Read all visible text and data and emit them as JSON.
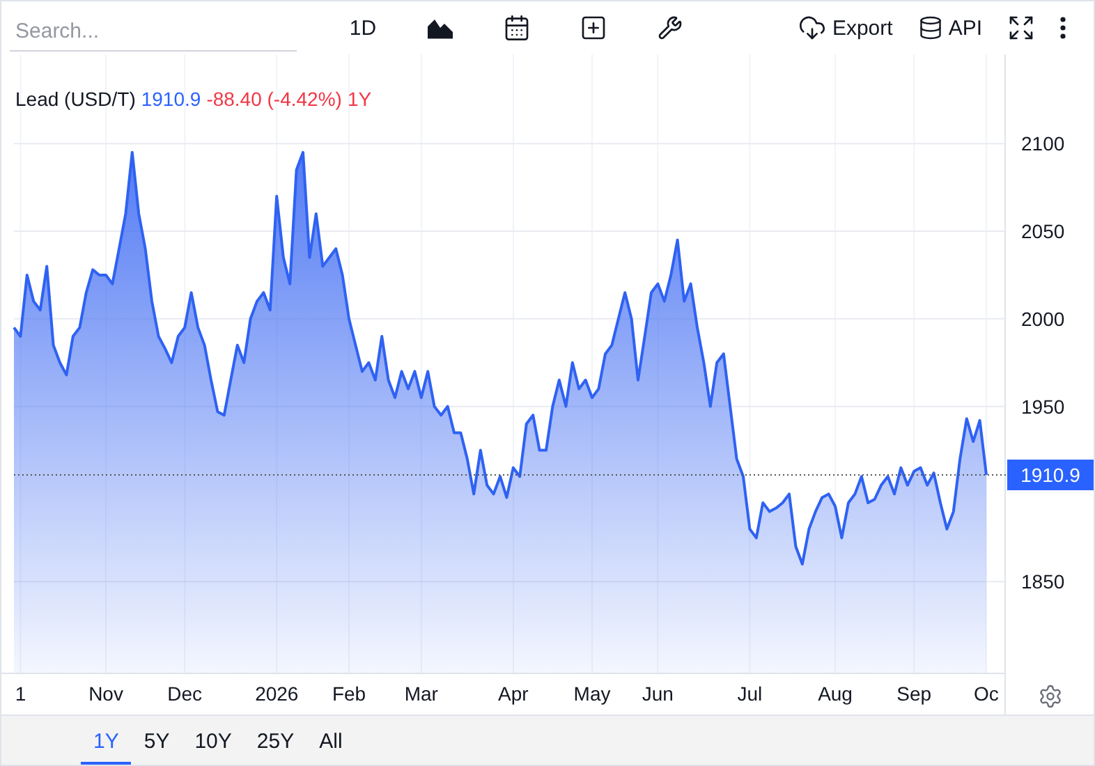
{
  "toolbar": {
    "search": {
      "placeholder": "Search..."
    },
    "range_label": "1D",
    "export_label": "Export",
    "api_label": "API"
  },
  "legend": {
    "price": "1910.9",
    "change": "-88.40 (-4.42%)",
    "period": "1Y"
  },
  "price_tag": "1910.9",
  "chart_data": {
    "type": "area",
    "series": [
      {
        "name": "Lead (USD/T)",
        "color": "#2f62f2",
        "values": [
          1995,
          1990,
          2025,
          2010,
          2005,
          2030,
          1985,
          1975,
          1968,
          1990,
          1995,
          2015,
          2028,
          2025,
          2025,
          2020,
          2040,
          2060,
          2095,
          2060,
          2040,
          2010,
          1990,
          1983,
          1975,
          1990,
          1995,
          2015,
          1995,
          1985,
          1965,
          1947,
          1945,
          1965,
          1985,
          1975,
          2000,
          2010,
          2015,
          2005,
          2070,
          2035,
          2020,
          2085,
          2095,
          2035,
          2060,
          2030,
          2035,
          2040,
          2025,
          2000,
          1985,
          1970,
          1975,
          1965,
          1990,
          1965,
          1955,
          1970,
          1960,
          1970,
          1955,
          1970,
          1950,
          1945,
          1950,
          1935,
          1935,
          1920,
          1900,
          1925,
          1905,
          1900,
          1910,
          1898,
          1915,
          1910,
          1940,
          1945,
          1925,
          1925,
          1950,
          1965,
          1950,
          1975,
          1960,
          1965,
          1955,
          1960,
          1980,
          1985,
          2000,
          2015,
          2000,
          1965,
          1990,
          2015,
          2020,
          2010,
          2025,
          2045,
          2010,
          2020,
          1995,
          1975,
          1950,
          1975,
          1980,
          1950,
          1920,
          1910,
          1880,
          1875,
          1895,
          1890,
          1892,
          1895,
          1900,
          1870,
          1860,
          1880,
          1890,
          1898,
          1900,
          1893,
          1875,
          1895,
          1900,
          1910,
          1895,
          1897,
          1905,
          1910,
          1900,
          1915,
          1905,
          1913,
          1915,
          1905,
          1912,
          1895,
          1880,
          1890,
          1920,
          1943,
          1930,
          1942,
          1910.9
        ]
      }
    ],
    "categories": [
      null,
      "1",
      null,
      null,
      null,
      null,
      null,
      null,
      null,
      null,
      null,
      null,
      null,
      null,
      "Nov",
      null,
      null,
      null,
      null,
      null,
      null,
      null,
      null,
      null,
      null,
      null,
      "Dec",
      null,
      null,
      null,
      null,
      null,
      null,
      null,
      null,
      null,
      null,
      null,
      null,
      null,
      "2026",
      null,
      null,
      null,
      null,
      null,
      null,
      null,
      null,
      null,
      null,
      "Feb",
      null,
      null,
      null,
      null,
      null,
      null,
      null,
      null,
      null,
      null,
      "Mar",
      null,
      null,
      null,
      null,
      null,
      null,
      null,
      null,
      null,
      null,
      null,
      null,
      null,
      "Apr",
      null,
      null,
      null,
      null,
      null,
      null,
      null,
      null,
      null,
      null,
      null,
      "May",
      null,
      null,
      null,
      null,
      null,
      null,
      null,
      null,
      null,
      "Jun",
      null,
      null,
      null,
      null,
      null,
      null,
      null,
      null,
      null,
      null,
      null,
      null,
      null,
      "Jul",
      null,
      null,
      null,
      null,
      null,
      null,
      null,
      null,
      null,
      null,
      null,
      null,
      "Aug",
      null,
      null,
      null,
      null,
      null,
      null,
      null,
      null,
      null,
      null,
      null,
      "Sep",
      null,
      null,
      null,
      null,
      null,
      null,
      null,
      null,
      null,
      null,
      "Oc"
    ],
    "ylim": [
      1798,
      2151
    ],
    "grid": true,
    "ref_lines": [
      {
        "axis": "y",
        "value": 1910.9
      }
    ],
    "yticks": [
      1850,
      1950,
      2000,
      2050,
      2100
    ]
  },
  "range_tabs": [
    {
      "label": "1Y",
      "selected": true
    },
    {
      "label": "5Y",
      "selected": false
    },
    {
      "label": "10Y",
      "selected": false
    },
    {
      "label": "25Y",
      "selected": false
    },
    {
      "label": "All",
      "selected": false
    }
  ]
}
